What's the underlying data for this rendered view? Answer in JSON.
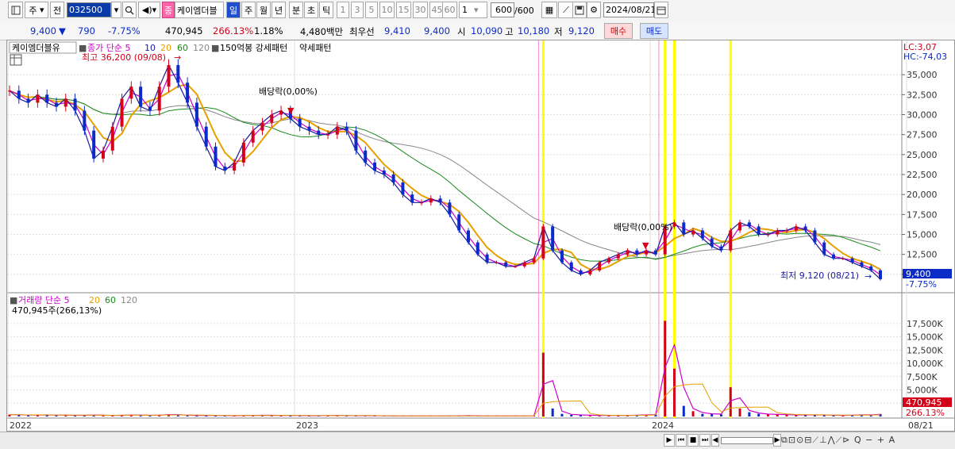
{
  "toolbar": {
    "market": "주",
    "prev_label": "전",
    "code": "032500",
    "stock_name": "케이엠더블",
    "stock_badge": "종",
    "periods": [
      "일",
      "주",
      "월",
      "년",
      "분",
      "초",
      "틱"
    ],
    "period_active": "일",
    "numbers": [
      "1",
      "3",
      "5",
      "10",
      "15",
      "30",
      "45",
      "60"
    ],
    "unit_value": "1",
    "count_value": "600",
    "count_total": "/600",
    "date": "2024/08/21"
  },
  "quote": {
    "price": "9,400",
    "change": "790",
    "change_pct": "-7.75%",
    "volume": "470,945",
    "volume_pct": "266.13%",
    "turnover_pct": "1.18%",
    "amount": "4,480백만",
    "best_label": "최우선",
    "bid": "9,410",
    "ask": "9,400",
    "open_label": "시",
    "open": "10,090",
    "high_label": "고",
    "high": "10,180",
    "low_label": "저",
    "low": "9,120",
    "buy_label": "매수",
    "sell_label": "매도"
  },
  "price_panel": {
    "stock_tag": "케이엠더블유",
    "close_label": "종가 단순 5",
    "ma": [
      "10",
      "20",
      "60",
      "120"
    ],
    "indicator1": "150억봉 강세패턴",
    "indicator2": "약세패턴",
    "lc": "LC:3,07",
    "hc": "HC:-74,03",
    "high_annot": "최고 36,200 (09/08)",
    "low_annot": "최저 9,120 (08/21)",
    "div_annot1": "배당락(0,00%)",
    "div_annot2": "배당락(0,00%)",
    "cur_price": "9,400",
    "cur_pct": "-7.75%"
  },
  "volume_panel": {
    "title": "거래량 단순 5",
    "ma": [
      "20",
      "60",
      "120"
    ],
    "info": "470,945주(266,13%)",
    "cur_volume": "470,945",
    "cur_pct": "266.13%"
  },
  "colors": {
    "up": "#d4001a",
    "down": "#0a2bc8",
    "ma5": "#1a1a9a",
    "ma10": "#cc00cc",
    "ma20": "#e6a000",
    "ma60": "#1a8a1a",
    "ma120": "#888888",
    "highlight": "#ffff00"
  },
  "chart_data": {
    "type": "line",
    "x_labels": [
      "2022",
      "2023",
      "2024",
      "08/21"
    ],
    "price_axis": [
      "35,000",
      "32,500",
      "30,000",
      "27,500",
      "25,000",
      "22,500",
      "20,000",
      "17,500",
      "15,000",
      "12,500",
      "10,000"
    ],
    "volume_axis": [
      "17,500K",
      "15,000K",
      "12,500K",
      "10,000K",
      "7,500K",
      "5,000K",
      "2,500K"
    ],
    "price_close": [
      33000,
      32000,
      31500,
      32500,
      31500,
      31000,
      32000,
      30500,
      28000,
      24500,
      25500,
      28500,
      32000,
      33500,
      31000,
      30500,
      33500,
      36200,
      34000,
      31500,
      28500,
      26000,
      23500,
      23000,
      24000,
      26500,
      28000,
      29000,
      30000,
      30500,
      29500,
      28500,
      28000,
      27500,
      27500,
      28500,
      28000,
      25500,
      24000,
      23000,
      22500,
      21500,
      20000,
      19000,
      19000,
      19500,
      19000,
      17500,
      15500,
      14000,
      12500,
      11500,
      11500,
      11000,
      11000,
      11500,
      12000,
      16000,
      13000,
      11500,
      10500,
      10000,
      10500,
      11500,
      12000,
      12500,
      13000,
      12500,
      13000,
      12500,
      16000,
      16500,
      15000,
      15500,
      14500,
      13500,
      13000,
      15500,
      16500,
      16000,
      15000,
      15000,
      15500,
      15500,
      16000,
      15500,
      14000,
      12500,
      12000,
      12000,
      11500,
      11000,
      10500,
      9400
    ],
    "volume": [
      0.35,
      0.3,
      0.25,
      0.3,
      0.3,
      0.25,
      0.25,
      0.2,
      0.25,
      0.3,
      0.2,
      0.2,
      0.25,
      0.3,
      0.25,
      0.2,
      0.3,
      0.4,
      0.3,
      0.2,
      0.2,
      0.2,
      0.2,
      0.15,
      0.15,
      0.2,
      0.2,
      0.25,
      0.2,
      0.2,
      0.2,
      0.15,
      0.15,
      0.15,
      0.2,
      0.2,
      0.15,
      0.15,
      0.15,
      0.15,
      0.1,
      0.1,
      0.1,
      0.1,
      0.1,
      0.1,
      0.1,
      0.1,
      0.15,
      0.15,
      0.1,
      0.1,
      0.1,
      0.1,
      0.1,
      0.1,
      0.15,
      12,
      1.5,
      0.5,
      0.3,
      0.3,
      0.2,
      0.2,
      0.2,
      0.2,
      0.2,
      0.3,
      0.3,
      0.4,
      18,
      9,
      2,
      1,
      0.5,
      0.5,
      0.4,
      5.5,
      1.5,
      0.8,
      0.5,
      0.4,
      0.4,
      0.3,
      0.3,
      0.3,
      0.3,
      0.3,
      0.2,
      0.2,
      0.3,
      0.3,
      0.3,
      0.47
    ],
    "ylim": [
      8000,
      37500
    ]
  }
}
